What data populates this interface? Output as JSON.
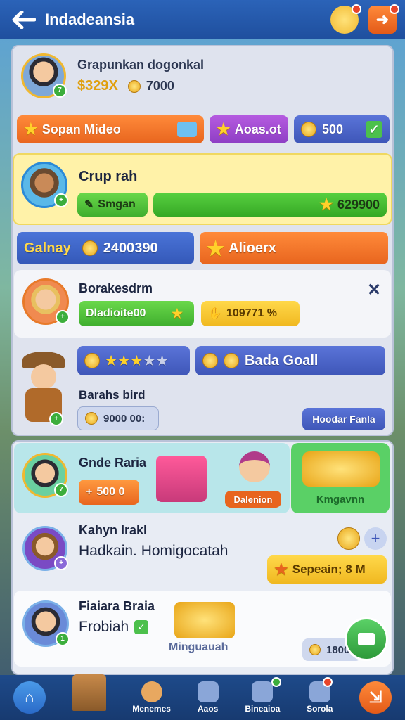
{
  "header": {
    "title": "Indadeansia"
  },
  "profile": {
    "name": "Grapunkan dogonkal",
    "cash": "$329X",
    "coins": "7000"
  },
  "tabs": [
    {
      "label": "Sopan Mideo"
    },
    {
      "label": "Aoas.ot"
    },
    {
      "label": "500"
    }
  ],
  "quest": {
    "title": "Crup rah",
    "button": "Smgan",
    "reward": "629900"
  },
  "stats": {
    "label": "Galnay",
    "value": "2400390",
    "action": "Alioerx"
  },
  "card1": {
    "name": "Borakesdrm",
    "chip1": "Dladioite00",
    "chip2": "109771 %"
  },
  "card2": {
    "chip": "Bada Goall",
    "name": "Barahs bird",
    "coins": "9000 00:",
    "button": "Hoodar Fanla"
  },
  "shop": {
    "name": "Gnde Raria",
    "price": "500 0",
    "tag": "Dalenion",
    "bundle": "Kmgavnn"
  },
  "list": [
    {
      "name": "Kahyn Irakl",
      "sub": "Hadkain. Homigocatah",
      "button": "Sepeain; 8 M"
    },
    {
      "name": "Fiaiara Braia",
      "sub": "Frobiah",
      "caption": "Minguauah",
      "chip": "1800"
    }
  ],
  "nav": [
    {
      "label": ""
    },
    {
      "label": ""
    },
    {
      "label": "Menemes"
    },
    {
      "label": "Aaos"
    },
    {
      "label": "Bineaioa"
    },
    {
      "label": "Sorola"
    },
    {
      "label": ""
    }
  ]
}
